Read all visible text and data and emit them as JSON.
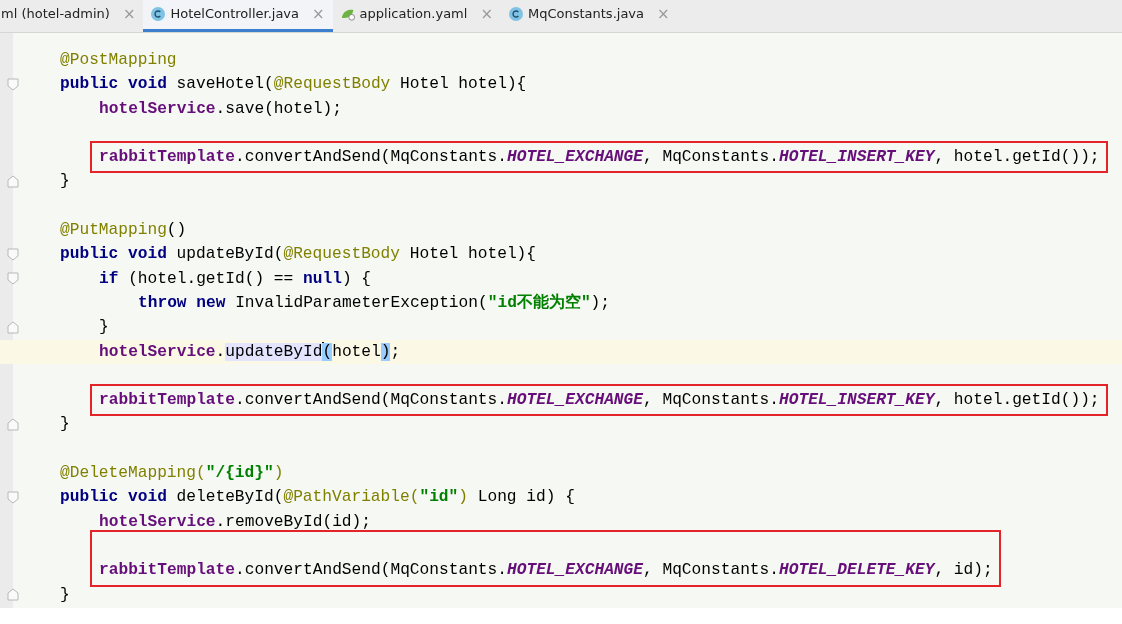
{
  "tabs": [
    {
      "label": "ml (hotel-admin)",
      "kind": "plain",
      "selected": false
    },
    {
      "label": "HotelController.java",
      "kind": "class",
      "selected": true
    },
    {
      "label": "application.yaml",
      "kind": "spring",
      "selected": false
    },
    {
      "label": "MqConstants.java",
      "kind": "class",
      "selected": false
    }
  ],
  "close_glyph": "×",
  "lines": [
    {
      "kind": "line",
      "tokens": [
        {
          "kind": "annotation",
          "text": "@PostMapping"
        }
      ]
    },
    {
      "kind": "line",
      "foldable": true,
      "tokens": [
        {
          "kind": "keyword",
          "text": "public void "
        },
        {
          "kind": "plain",
          "text": "saveHotel("
        },
        {
          "kind": "annotation",
          "text": "@RequestBody "
        },
        {
          "kind": "plain",
          "text": "Hotel hotel){"
        }
      ],
      "children": [
        {
          "kind": "line",
          "tokens": [
            {
              "kind": "field",
              "text": "hotelService"
            },
            {
              "kind": "plain",
              "text": ".save(hotel);"
            }
          ]
        },
        {
          "kind": "blank"
        },
        {
          "kind": "box",
          "lines": [
            {
              "kind": "line",
              "tokens": [
                {
                  "kind": "field",
                  "text": "rabbitTemplate"
                },
                {
                  "kind": "plain",
                  "text": ".convertAndSend(MqConstants."
                },
                {
                  "kind": "static",
                  "text": "HOTEL_EXCHANGE"
                },
                {
                  "kind": "plain",
                  "text": ", MqConstants."
                },
                {
                  "kind": "static",
                  "text": "HOTEL_INSERT_KEY"
                },
                {
                  "kind": "plain",
                  "text": ", hotel.getId());"
                }
              ]
            }
          ]
        }
      ]
    },
    {
      "kind": "line",
      "fold_end": true,
      "tokens": [
        {
          "kind": "plain",
          "text": "}"
        }
      ]
    },
    {
      "kind": "blank"
    },
    {
      "kind": "line",
      "tokens": [
        {
          "kind": "annotation",
          "text": "@PutMapping"
        },
        {
          "kind": "plain",
          "text": "()"
        }
      ]
    },
    {
      "kind": "line",
      "foldable": true,
      "tokens": [
        {
          "kind": "keyword",
          "text": "public void "
        },
        {
          "kind": "plain",
          "text": "updateById("
        },
        {
          "kind": "annotation",
          "text": "@RequestBody "
        },
        {
          "kind": "plain",
          "text": "Hotel hotel){"
        }
      ],
      "children": [
        {
          "kind": "line",
          "foldable": true,
          "tokens": [
            {
              "kind": "keyword",
              "text": "if "
            },
            {
              "kind": "plain",
              "text": "(hotel.getId() == "
            },
            {
              "kind": "keyword",
              "text": "null"
            },
            {
              "kind": "plain",
              "text": ") {"
            }
          ],
          "children": [
            {
              "kind": "line",
              "tokens": [
                {
                  "kind": "keyword",
                  "text": "throw new "
                },
                {
                  "kind": "plain",
                  "text": "InvalidParameterException("
                },
                {
                  "kind": "string",
                  "text": "\"id不能为空\""
                },
                {
                  "kind": "plain",
                  "text": ");"
                }
              ]
            }
          ]
        },
        {
          "kind": "line",
          "fold_end": true,
          "tokens": [
            {
              "kind": "plain",
              "text": "}"
            }
          ]
        },
        {
          "kind": "line",
          "current": true,
          "tokens": [
            {
              "kind": "field",
              "text": "hotelService"
            },
            {
              "kind": "plain",
              "text": "."
            },
            {
              "kind": "plain",
              "text": "updateById",
              "highlighted": true,
              "caret": true
            },
            {
              "kind": "plain",
              "text": "(",
              "matched": true
            },
            {
              "kind": "plain",
              "text": "hotel"
            },
            {
              "kind": "plain",
              "text": ")",
              "matched": true
            },
            {
              "kind": "plain",
              "text": ";"
            }
          ]
        },
        {
          "kind": "blank"
        },
        {
          "kind": "box",
          "lines": [
            {
              "kind": "line",
              "tokens": [
                {
                  "kind": "field",
                  "text": "rabbitTemplate"
                },
                {
                  "kind": "plain",
                  "text": ".convertAndSend(MqConstants."
                },
                {
                  "kind": "static",
                  "text": "HOTEL_EXCHANGE"
                },
                {
                  "kind": "plain",
                  "text": ", MqConstants."
                },
                {
                  "kind": "static",
                  "text": "HOTEL_INSERT_KEY"
                },
                {
                  "kind": "plain",
                  "text": ", hotel.getId());"
                }
              ]
            }
          ]
        }
      ]
    },
    {
      "kind": "line",
      "fold_end": true,
      "tokens": [
        {
          "kind": "plain",
          "text": "}"
        }
      ]
    },
    {
      "kind": "blank"
    },
    {
      "kind": "line",
      "tokens": [
        {
          "kind": "annotation",
          "text": "@DeleteMapping("
        },
        {
          "kind": "string",
          "text": "\"/{id}\""
        },
        {
          "kind": "annotation",
          "text": ")"
        }
      ]
    },
    {
      "kind": "line",
      "foldable": true,
      "tokens": [
        {
          "kind": "keyword",
          "text": "public void "
        },
        {
          "kind": "plain",
          "text": "deleteById("
        },
        {
          "kind": "annotation",
          "text": "@PathVariable("
        },
        {
          "kind": "string",
          "text": "\"id\""
        },
        {
          "kind": "annotation",
          "text": ")"
        },
        {
          "kind": "plain",
          "text": " Long id) {"
        }
      ],
      "children": [
        {
          "kind": "line",
          "tokens": [
            {
              "kind": "field",
              "text": "hotelService"
            },
            {
              "kind": "plain",
              "text": ".removeById(id);"
            }
          ]
        },
        {
          "kind": "box",
          "lines": [
            {
              "kind": "blank"
            },
            {
              "kind": "line",
              "tokens": [
                {
                  "kind": "field",
                  "text": "rabbitTemplate"
                },
                {
                  "kind": "plain",
                  "text": ".convertAndSend(MqConstants."
                },
                {
                  "kind": "static",
                  "text": "HOTEL_EXCHANGE"
                },
                {
                  "kind": "plain",
                  "text": ", MqConstants."
                },
                {
                  "kind": "static",
                  "text": "HOTEL_DELETE_KEY"
                },
                {
                  "kind": "plain",
                  "text": ", id);"
                }
              ]
            }
          ]
        }
      ]
    },
    {
      "kind": "line",
      "fold_end": true,
      "tokens": [
        {
          "kind": "plain",
          "text": "}"
        }
      ]
    }
  ]
}
